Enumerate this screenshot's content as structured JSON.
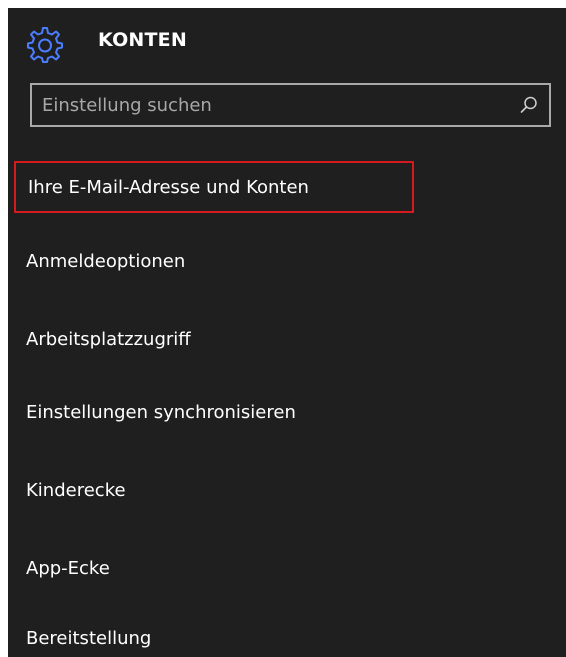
{
  "header": {
    "title": "KONTEN",
    "icon": "gear-icon",
    "icon_color": "#4a7eff"
  },
  "search": {
    "placeholder": "Einstellung suchen",
    "value": "",
    "icon": "search-icon"
  },
  "menu": {
    "items": [
      {
        "label": "Ihre E-Mail-Adresse und Konten",
        "highlighted": true,
        "highlight_color": "#d41a1f"
      },
      {
        "label": "Anmeldeoptionen"
      },
      {
        "label": "Arbeitsplatzzugriff"
      },
      {
        "label": "Einstellungen synchronisieren"
      },
      {
        "label": "Kinderecke"
      },
      {
        "label": "App-Ecke"
      },
      {
        "label": "Bereitstellung"
      }
    ]
  }
}
